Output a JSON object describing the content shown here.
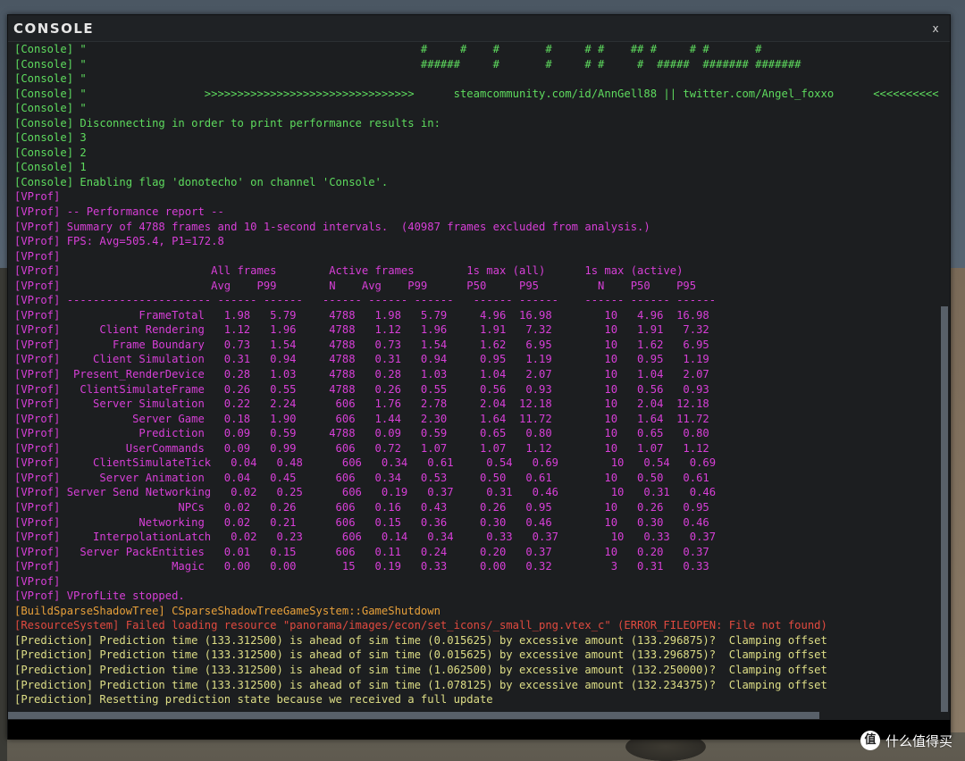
{
  "window": {
    "title": "CONSOLE",
    "close_label": "x"
  },
  "log_lines": [
    {
      "kind": "console",
      "text": "[Console] \"                                                   #     #    #       #     # #    ## #     # #       #"
    },
    {
      "kind": "console",
      "text": "[Console] \"                                                   ######     #       #     # #     #  #####  ####### #######"
    },
    {
      "kind": "console",
      "text": "[Console] \""
    },
    {
      "kind": "console",
      "text": "[Console] \"                  >>>>>>>>>>>>>>>>>>>>>>>>>>>>>>>>      steamcommunity.com/id/AnnGell88 || twitter.com/Angel_foxxo      <<<<<<<<<<<<<<<<<<<<<<<<<<<<<<<<"
    },
    {
      "kind": "console",
      "text": "[Console] \""
    },
    {
      "kind": "console",
      "text": "[Console] Disconnecting in order to print performance results in:"
    },
    {
      "kind": "console",
      "text": "[Console] 3"
    },
    {
      "kind": "console",
      "text": "[Console] 2"
    },
    {
      "kind": "console",
      "text": "[Console] 1"
    },
    {
      "kind": "console",
      "text": "[Console] Enabling flag 'donotecho' on channel 'Console'."
    },
    {
      "kind": "vprof",
      "text": "[VProf]"
    },
    {
      "kind": "vprof",
      "text": "[VProf] -- Performance report --"
    },
    {
      "kind": "vprof",
      "text": "[VProf] Summary of 4788 frames and 10 1-second intervals.  (40987 frames excluded from analysis.)"
    },
    {
      "kind": "vprof",
      "text": "[VProf] FPS: Avg=505.4, P1=172.8"
    },
    {
      "kind": "vprof",
      "text": "[VProf]"
    },
    {
      "kind": "vprof",
      "text": "[VProf]                       All frames        Active frames        1s max (all)      1s max (active)"
    },
    {
      "kind": "vprof",
      "text": "[VProf]                       Avg    P99        N    Avg    P99      P50     P95         N    P50    P95"
    },
    {
      "kind": "vprof",
      "text": "[VProf] ---------------------- ------ ------   ------ ------ ------   ------ ------    ------ ------ ------"
    },
    {
      "kind": "vprof",
      "text": "[VProf]            FrameTotal   1.98   5.79     4788   1.98   5.79     4.96  16.98        10   4.96  16.98"
    },
    {
      "kind": "vprof",
      "text": "[VProf]      Client Rendering   1.12   1.96     4788   1.12   1.96     1.91   7.32        10   1.91   7.32"
    },
    {
      "kind": "vprof",
      "text": "[VProf]        Frame Boundary   0.73   1.54     4788   0.73   1.54     1.62   6.95        10   1.62   6.95"
    },
    {
      "kind": "vprof",
      "text": "[VProf]     Client Simulation   0.31   0.94     4788   0.31   0.94     0.95   1.19        10   0.95   1.19"
    },
    {
      "kind": "vprof",
      "text": "[VProf]  Present_RenderDevice   0.28   1.03     4788   0.28   1.03     1.04   2.07        10   1.04   2.07"
    },
    {
      "kind": "vprof",
      "text": "[VProf]   ClientSimulateFrame   0.26   0.55     4788   0.26   0.55     0.56   0.93        10   0.56   0.93"
    },
    {
      "kind": "vprof",
      "text": "[VProf]     Server Simulation   0.22   2.24      606   1.76   2.78     2.04  12.18        10   2.04  12.18"
    },
    {
      "kind": "vprof",
      "text": "[VProf]           Server Game   0.18   1.90      606   1.44   2.30     1.64  11.72        10   1.64  11.72"
    },
    {
      "kind": "vprof",
      "text": "[VProf]            Prediction   0.09   0.59     4788   0.09   0.59     0.65   0.80        10   0.65   0.80"
    },
    {
      "kind": "vprof",
      "text": "[VProf]          UserCommands   0.09   0.99      606   0.72   1.07     1.07   1.12        10   1.07   1.12"
    },
    {
      "kind": "vprof",
      "text": "[VProf]     ClientSimulateTick   0.04   0.48      606   0.34   0.61     0.54   0.69        10   0.54   0.69"
    },
    {
      "kind": "vprof",
      "text": "[VProf]      Server Animation   0.04   0.45      606   0.34   0.53     0.50   0.61        10   0.50   0.61"
    },
    {
      "kind": "vprof",
      "text": "[VProf] Server Send Networking   0.02   0.25      606   0.19   0.37     0.31   0.46        10   0.31   0.46"
    },
    {
      "kind": "vprof",
      "text": "[VProf]                  NPCs   0.02   0.26      606   0.16   0.43     0.26   0.95        10   0.26   0.95"
    },
    {
      "kind": "vprof",
      "text": "[VProf]            Networking   0.02   0.21      606   0.15   0.36     0.30   0.46        10   0.30   0.46"
    },
    {
      "kind": "vprof",
      "text": "[VProf]     InterpolationLatch   0.02   0.23      606   0.14   0.34     0.33   0.37        10   0.33   0.37"
    },
    {
      "kind": "vprof",
      "text": "[VProf]   Server PackEntities   0.01   0.15      606   0.11   0.24     0.20   0.37        10   0.20   0.37"
    },
    {
      "kind": "vprof",
      "text": "[VProf]                 Magic   0.00   0.00       15   0.19   0.33     0.00   0.32         3   0.31   0.33"
    },
    {
      "kind": "vprof",
      "text": "[VProf]"
    },
    {
      "kind": "vprof",
      "text": "[VProf] VProfLite stopped."
    },
    {
      "kind": "build",
      "text": "[BuildSparseShadowTree] CSparseShadowTreeGameSystem::GameShutdown"
    },
    {
      "kind": "error",
      "text": "[ResourceSystem] Failed loading resource \"panorama/images/econ/set_icons/_small_png.vtex_c\" (ERROR_FILEOPEN: File not found)"
    },
    {
      "kind": "pred",
      "text": "[Prediction] Prediction time (133.312500) is ahead of sim time (0.015625) by excessive amount (133.296875)?  Clamping offset"
    },
    {
      "kind": "pred",
      "text": "[Prediction] Prediction time (133.312500) is ahead of sim time (0.015625) by excessive amount (133.296875)?  Clamping offset"
    },
    {
      "kind": "pred",
      "text": "[Prediction] Prediction time (133.312500) is ahead of sim time (1.062500) by excessive amount (132.250000)?  Clamping offset"
    },
    {
      "kind": "pred",
      "text": "[Prediction] Prediction time (133.312500) is ahead of sim time (1.078125) by excessive amount (132.234375)?  Clamping offset"
    },
    {
      "kind": "pred",
      "text": "[Prediction] Resetting prediction state because we received a full update"
    }
  ],
  "command_input": {
    "value": "",
    "placeholder": ""
  },
  "watermark": {
    "icon_glyph": "值",
    "text": "什么值得买"
  },
  "colors": {
    "console": "#5edb5e",
    "vprof": "#d73fd7",
    "build": "#e7a03a",
    "error": "#e14a3f",
    "prediction": "#dede86",
    "window_bg": "#1c1e20",
    "scrollbar_thumb": "#586069"
  }
}
